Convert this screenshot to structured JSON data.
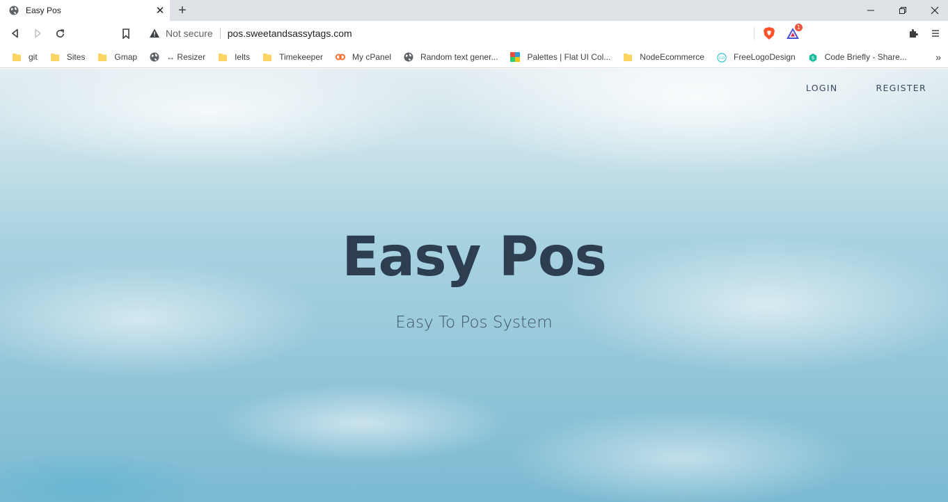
{
  "browser": {
    "tab": {
      "title": "Easy Pos"
    },
    "new_tab_label": "+",
    "window_controls": {
      "minimize": "—",
      "restore": "❐",
      "close": "✕"
    },
    "omnibox": {
      "security_text": "Not secure",
      "url": "pos.sweetandsassytags.com",
      "extension_badge": "1"
    },
    "bookmarks": [
      {
        "label": "git",
        "icon": "folder-icon"
      },
      {
        "label": "Sites",
        "icon": "folder-icon"
      },
      {
        "label": "Gmap",
        "icon": "folder-icon"
      },
      {
        "label": "↔ Resizer",
        "icon": "globe-icon"
      },
      {
        "label": "Ielts",
        "icon": "folder-icon"
      },
      {
        "label": "Timekeeper",
        "icon": "folder-icon"
      },
      {
        "label": "My cPanel",
        "icon": "cpanel-icon"
      },
      {
        "label": "Random text gener...",
        "icon": "globe-icon"
      },
      {
        "label": "Palettes | Flat UI Col...",
        "icon": "palette-icon"
      },
      {
        "label": "NodeEcommerce",
        "icon": "folder-icon"
      },
      {
        "label": "FreeLogoDesign",
        "icon": "flo-icon"
      },
      {
        "label": "Code Briefly - Share...",
        "icon": "dollar-icon"
      }
    ],
    "bookmarks_overflow": "»"
  },
  "page": {
    "nav": {
      "login": "LOGIN",
      "register": "REGISTER"
    },
    "hero": {
      "title": "Easy Pos",
      "subtitle": "Easy To Pos System"
    }
  },
  "colors": {
    "folder": "#fcd462",
    "title": "#2c3e50",
    "nav_text": "#34495e",
    "brave": "#fb542b"
  }
}
